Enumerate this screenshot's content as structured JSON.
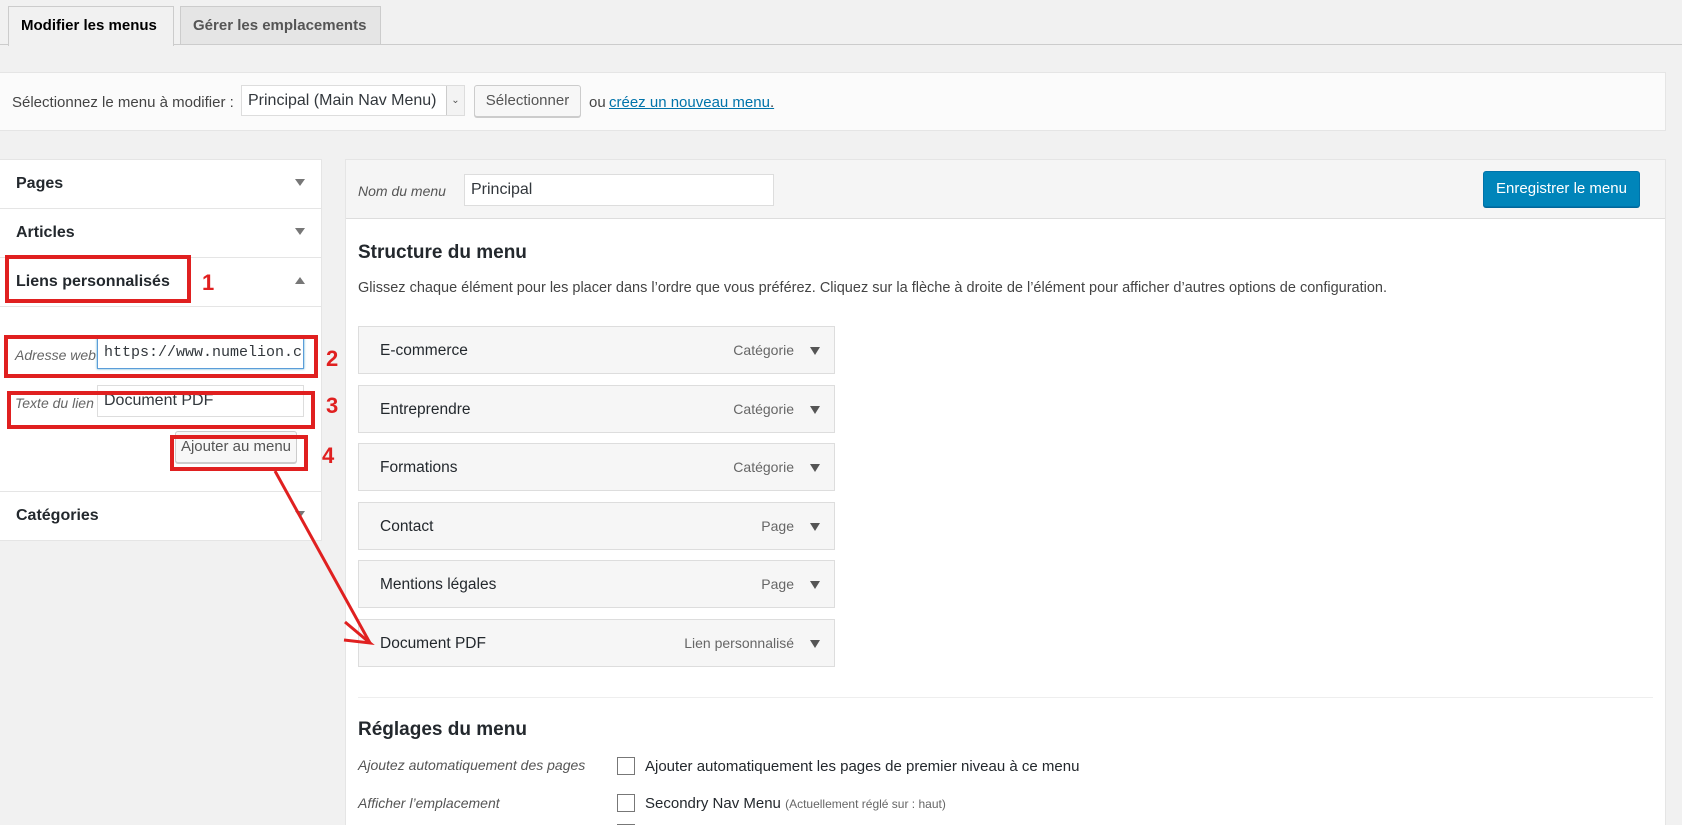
{
  "tabs": {
    "active": "Modifier les menus",
    "inactive": "Gérer les emplacements"
  },
  "select_bar": {
    "label": "Sélectionnez le menu à modifier :",
    "selected": "Principal (Main Nav Menu)",
    "button": "Sélectionner",
    "or": "ou",
    "link": "créez un nouveau menu",
    "period": "."
  },
  "left": {
    "pages": "Pages",
    "articles": "Articles",
    "liens": "Liens personnalisés",
    "url_label": "Adresse web",
    "url_value": "https://www.numelion.c",
    "text_label": "Texte du lien",
    "text_value": "Document PDF",
    "add_button": "Ajouter au menu",
    "categories": "Catégories"
  },
  "annotations": [
    "1",
    "2",
    "3",
    "4"
  ],
  "annotation_color": "#e02020",
  "right": {
    "name_label": "Nom du menu",
    "name_value": "Principal",
    "save_button": "Enregistrer le menu",
    "structure_title": "Structure du menu",
    "structure_desc": "Glissez chaque élément pour les placer dans l’ordre que vous préférez. Cliquez sur la flèche à droite de l’élément pour afficher d’autres options de configuration.",
    "items": [
      {
        "name": "E-commerce",
        "type": "Catégorie"
      },
      {
        "name": "Entreprendre",
        "type": "Catégorie"
      },
      {
        "name": "Formations",
        "type": "Catégorie"
      },
      {
        "name": "Contact",
        "type": "Page"
      },
      {
        "name": "Mentions légales",
        "type": "Page"
      },
      {
        "name": "Document PDF",
        "type": "Lien personnalisé"
      }
    ],
    "settings_title": "Réglages du menu",
    "auto_label": "Ajoutez automatiquement des pages",
    "auto_text": "Ajouter automatiquement les pages de premier niveau à ce menu",
    "location_label": "Afficher l’emplacement",
    "location_text": "Secondry Nav Menu",
    "location_note": "(Actuellement réglé sur : haut)"
  },
  "colors": {
    "primary": "#0085ba",
    "link": "#0073aa",
    "annotation": "#e02020"
  }
}
